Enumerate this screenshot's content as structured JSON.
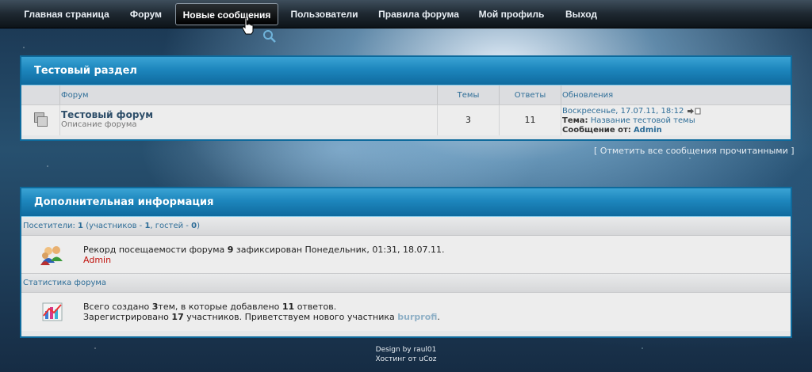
{
  "nav": {
    "items": [
      {
        "label": "Главная страница"
      },
      {
        "label": "Форум"
      },
      {
        "label": "Новые сообщения"
      },
      {
        "label": "Пользователи"
      },
      {
        "label": "Правила форума"
      },
      {
        "label": "Мой профиль"
      },
      {
        "label": "Выход"
      }
    ],
    "active_index": 2
  },
  "section": {
    "title": "Тестовый раздел",
    "columns": {
      "forum": "Форум",
      "topics": "Темы",
      "replies": "Ответы",
      "updates": "Обновления"
    },
    "forum": {
      "name": "Тестовый форум",
      "description": "Описание форума",
      "topics": "3",
      "replies": "11",
      "last_date": "Воскресенье, 17.07.11, 18:12",
      "topic_label": "Тема:",
      "topic_name": "Название тестовой темы",
      "message_label": "Сообщение от:",
      "message_author": "Admin"
    },
    "mark_read": "[ Отметить все сообщения прочитанными ]"
  },
  "info": {
    "title": "Дополнительная информация",
    "visitors": {
      "label": "Посетители:",
      "count": "1",
      "mid": "(участников -",
      "members": "1",
      "comma": ", гостей -",
      "guests": "0",
      "close": ")"
    },
    "record": {
      "prefix": "Рекорд посещаемости форума",
      "count": "9",
      "suffix": "зафиксирован Понедельник, 01:31, 18.07.11.",
      "user": "Admin"
    },
    "stats_label": "Статистика форума",
    "stats": {
      "line1_a": "Всего создано",
      "topics": "3",
      "line1_b": "тем, в которые добавлено",
      "replies": "11",
      "line1_c": "ответов.",
      "line2_a": "Зарегистрировано",
      "members": "17",
      "line2_b": "участников. Приветствуем нового участника",
      "newest": "burprofi",
      "line2_c": "."
    }
  },
  "footer": {
    "design": "Design by raul01",
    "hosting": "Хостинг от uCoz"
  },
  "colors": {
    "accent": "#1d86bd",
    "link": "#2f6e98",
    "alert": "#c0120c"
  }
}
